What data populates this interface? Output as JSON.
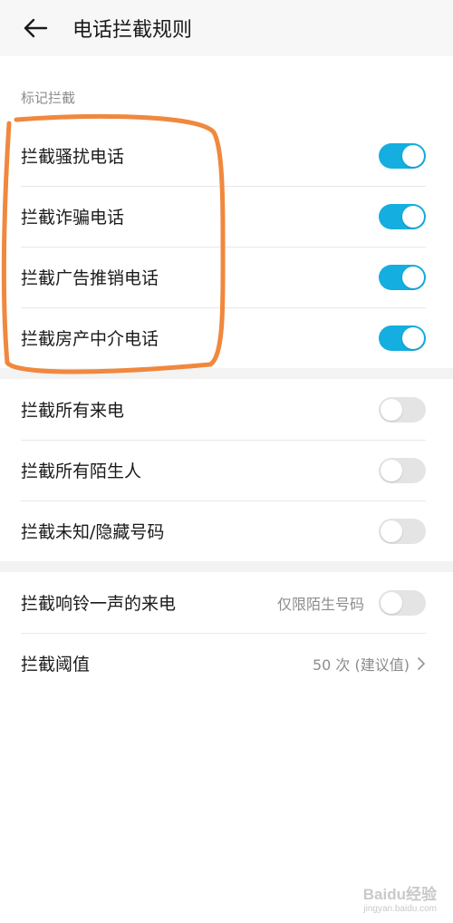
{
  "header": {
    "title": "电话拦截规则",
    "back_icon": "arrow-left-icon"
  },
  "marked_section": {
    "label": "标记拦截",
    "items": [
      {
        "label": "拦截骚扰电话",
        "enabled": true
      },
      {
        "label": "拦截诈骗电话",
        "enabled": true
      },
      {
        "label": "拦截广告推销电话",
        "enabled": true
      },
      {
        "label": "拦截房产中介电话",
        "enabled": true
      }
    ]
  },
  "all_section": {
    "items": [
      {
        "label": "拦截所有来电",
        "enabled": false
      },
      {
        "label": "拦截所有陌生人",
        "enabled": false
      },
      {
        "label": "拦截未知/隐藏号码",
        "enabled": false
      }
    ]
  },
  "ring_once": {
    "label": "拦截响铃一声的来电",
    "hint": "仅限陌生号码",
    "enabled": false
  },
  "threshold": {
    "label": "拦截阈值",
    "value": "50 次 (建议值)"
  },
  "colors": {
    "toggle_on": "#14aee0",
    "toggle_off": "#e4e4e4",
    "annotation": "#f0883e"
  },
  "watermark": {
    "main": "Baidu经验",
    "sub": "jingyan.baidu.com"
  }
}
